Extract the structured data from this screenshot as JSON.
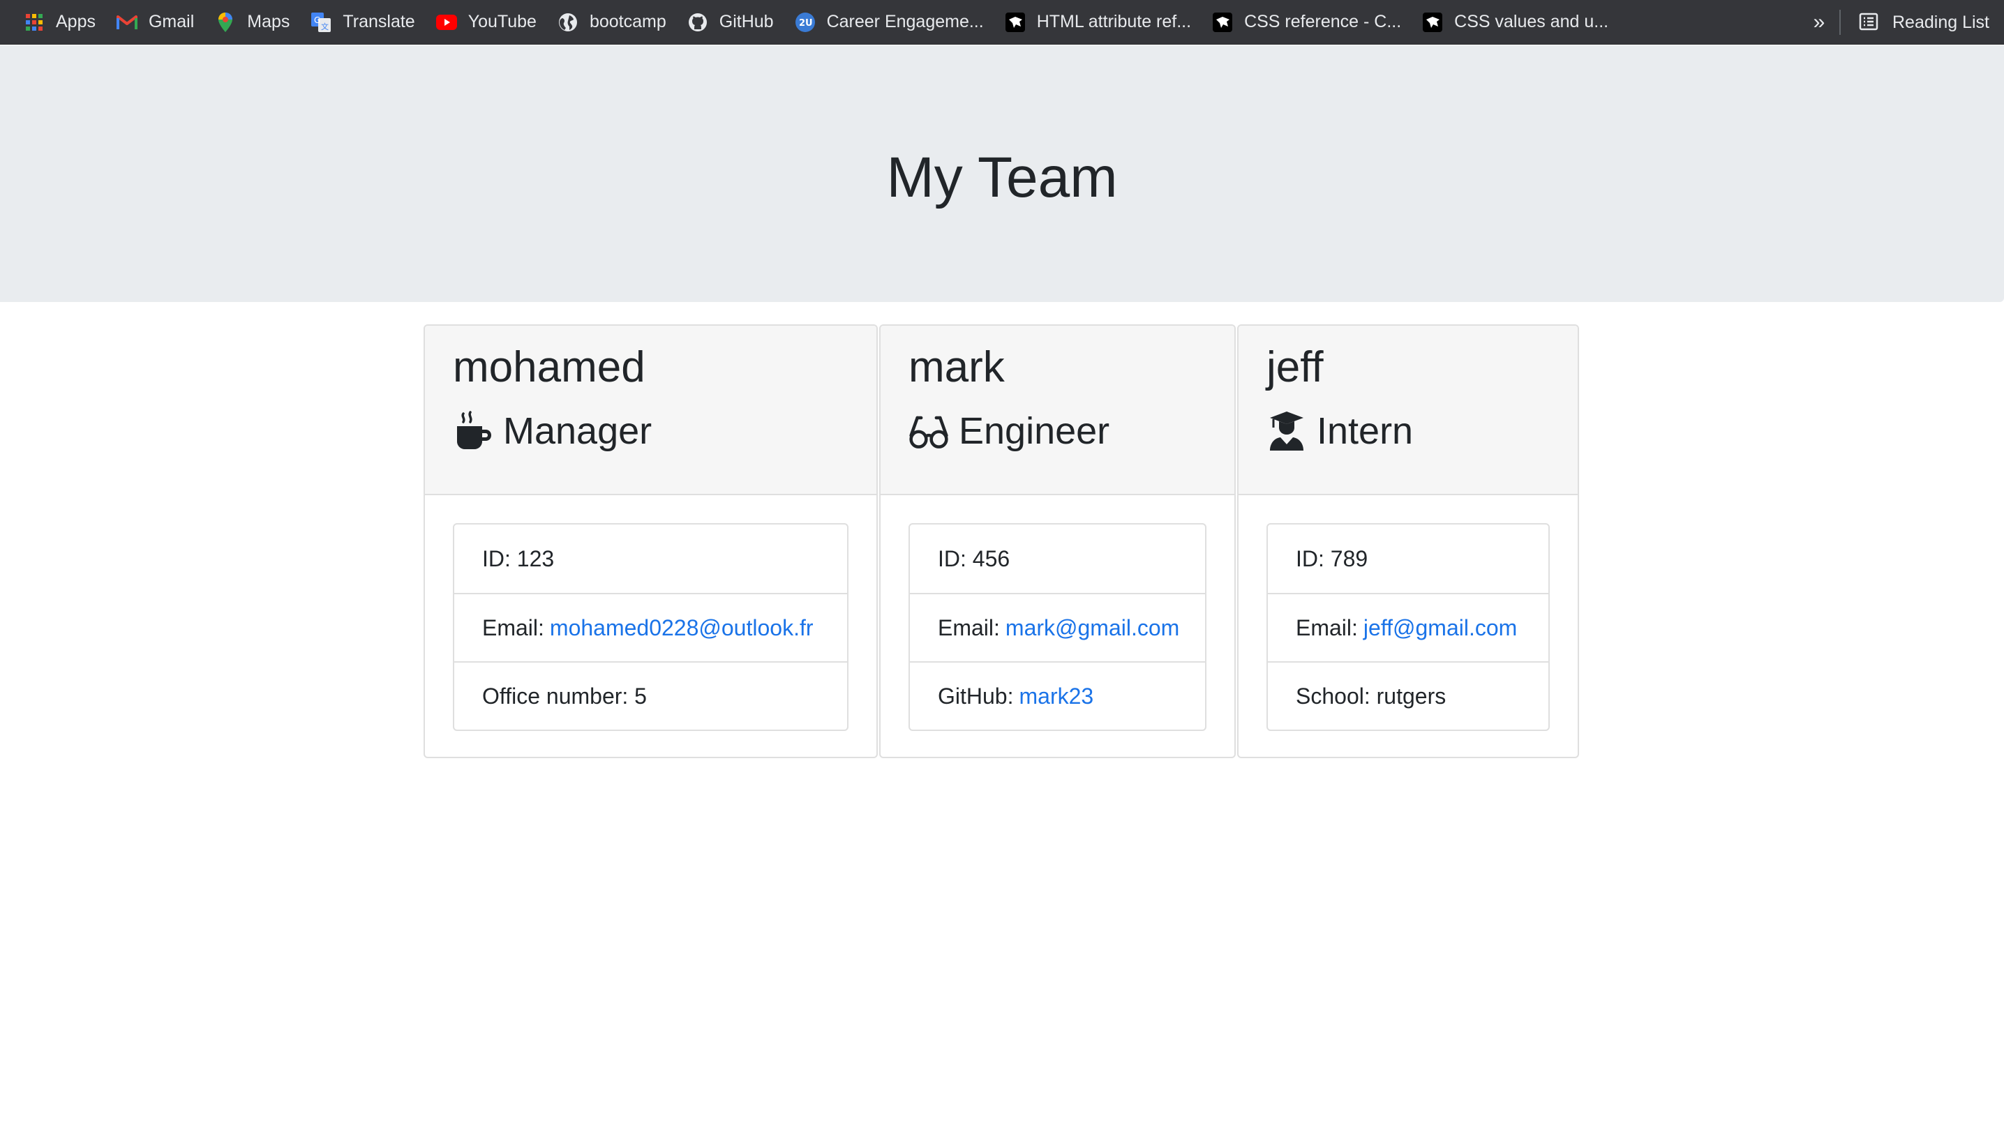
{
  "bookmarks": [
    {
      "label": "Apps",
      "icon": "apps-grid-icon"
    },
    {
      "label": "Gmail",
      "icon": "gmail-icon"
    },
    {
      "label": "Maps",
      "icon": "maps-pin-icon"
    },
    {
      "label": "Translate",
      "icon": "translate-icon"
    },
    {
      "label": "YouTube",
      "icon": "youtube-icon"
    },
    {
      "label": "bootcamp",
      "icon": "globe-icon"
    },
    {
      "label": "GitHub",
      "icon": "github-icon"
    },
    {
      "label": "Career Engageme...",
      "icon": "2u-icon"
    },
    {
      "label": "HTML attribute ref...",
      "icon": "mdn-icon"
    },
    {
      "label": "CSS reference - C...",
      "icon": "mdn-icon"
    },
    {
      "label": "CSS values and u...",
      "icon": "mdn-icon"
    }
  ],
  "bookmarks_more": "»",
  "reading_list": "Reading List",
  "header": {
    "title": "My Team"
  },
  "team": [
    {
      "name": "mohamed",
      "role": "Manager",
      "role_icon": "mug-icon",
      "id_label": "ID:",
      "id": "123",
      "email_label": "Email:",
      "email": "mohamed0228@outlook.fr",
      "extra_label": "Office number:",
      "extra": "5"
    },
    {
      "name": "mark",
      "role": "Engineer",
      "role_icon": "glasses-icon",
      "id_label": "ID:",
      "id": "456",
      "email_label": "Email:",
      "email": "mark@gmail.com",
      "extra_label": "GitHub:",
      "extra": "mark23"
    },
    {
      "name": "jeff",
      "role": "Intern",
      "role_icon": "graduate-icon",
      "id_label": "ID:",
      "id": "789",
      "email_label": "Email:",
      "email": "jeff@gmail.com",
      "extra_label": "School:",
      "extra": "rutgers"
    }
  ],
  "colors": {
    "link": "#1a73e8",
    "jumbotron": "#e9ecef",
    "bookmarks_bar": "#35363a"
  }
}
